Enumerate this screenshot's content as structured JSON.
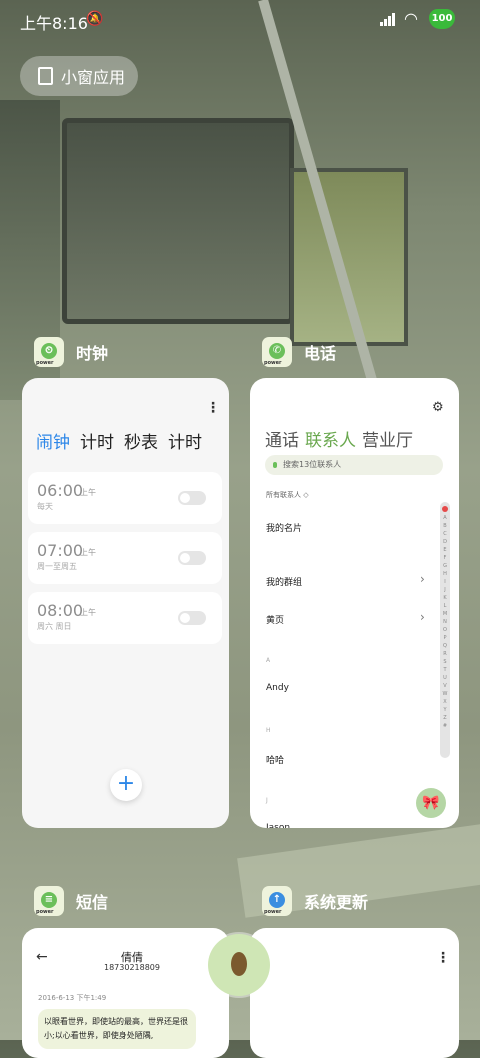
{
  "status": {
    "time": "上午8:16",
    "battery": "100"
  },
  "float_button": {
    "label": "小窗应用"
  },
  "cards": {
    "clock": {
      "title": "时钟",
      "tabs": [
        "闹钟",
        "计时",
        "秒表",
        "计时"
      ],
      "alarms": [
        {
          "time": "06:00",
          "ampm": "上午",
          "repeat": "每天"
        },
        {
          "time": "07:00",
          "ampm": "上午",
          "repeat": "周一至周五"
        },
        {
          "time": "08:00",
          "ampm": "上午",
          "repeat": "周六 周日"
        }
      ]
    },
    "phone": {
      "title": "电话",
      "tabs": [
        "通话",
        "联系人",
        "营业厅"
      ],
      "search_placeholder": "搜索13位联系人",
      "filter": "所有联系人",
      "rows": {
        "my_card": "我的名片",
        "my_groups": "我的群组",
        "yellow_pages": "黄页"
      },
      "section_a": "A",
      "contact_a": "Andy",
      "section_h": "H",
      "contact_h": "哈哈",
      "section_j": "J",
      "contact_j": "Jason",
      "index_letters": [
        "A",
        "B",
        "C",
        "D",
        "E",
        "F",
        "G",
        "H",
        "I",
        "J",
        "K",
        "L",
        "M",
        "N",
        "O",
        "P",
        "Q",
        "R",
        "S",
        "T",
        "U",
        "V",
        "W",
        "X",
        "Y",
        "Z",
        "#"
      ]
    },
    "sms": {
      "title": "短信",
      "contact_name": "倩倩",
      "contact_number": "18730218809",
      "date": "2016-6-13 下午1:49",
      "message": "以眼看世界，即使站的最高，世界还是很小;以心看世界，即使身处陋隅,"
    },
    "update": {
      "title": "系统更新"
    }
  }
}
